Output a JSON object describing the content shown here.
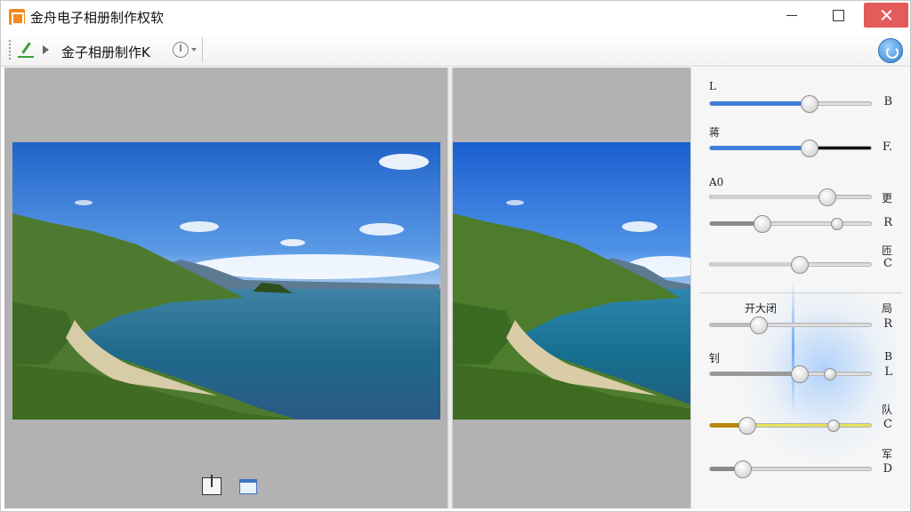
{
  "window": {
    "title": "金舟电子相册制作权软",
    "minimize_icon": "minimize-icon",
    "maximize_icon": "maximize-icon",
    "close_icon": "close-icon",
    "close_color": "#e35b5b"
  },
  "toolbar": {
    "label": "金子相册制作K",
    "edit_icon": "pen-icon",
    "play_icon": "play-icon",
    "clock_icon": "clock-icon",
    "help_icon": "help-icon"
  },
  "canvas": {
    "bottom_icons": [
      "insert-page-icon",
      "frame-icon"
    ]
  },
  "adjustments": [
    {
      "label": "L",
      "value": "B",
      "level": 0.61,
      "fill": "#3e7fd6"
    },
    {
      "label": "蒋",
      "value": "F.",
      "level": 0.61,
      "fill": "#3e7fd6",
      "rest": "#111111"
    },
    {
      "label": "A0",
      "value": "",
      "level": 0.72,
      "fill": "#d0d0d0",
      "extra_label": "更"
    },
    {
      "label": "",
      "value": "R",
      "level": 0.32,
      "fill": "#8a8a8a",
      "second_level": 0.78,
      "extra_label": ""
    },
    {
      "label": "",
      "value": "C",
      "level": 0.55,
      "fill": "#d0d0d0",
      "extra_label": "匝"
    },
    {
      "label": "开大闭",
      "value": "R",
      "level": 0.3,
      "fill": "#bdbdbd",
      "extra_label": "局"
    },
    {
      "label": "钊",
      "value": "L",
      "level": 0.55,
      "fill": "#9a9a9a",
      "second_level": 0.74,
      "extra_label": "B"
    },
    {
      "label": "",
      "value": "C",
      "level": 0.23,
      "fill": "#b8860b",
      "second_level": 0.76,
      "extra_label": "队",
      "rest": "#e6e060"
    },
    {
      "label": "",
      "value": "D",
      "level": 0.2,
      "fill": "#8a8a8a",
      "extra_label": "军"
    }
  ]
}
